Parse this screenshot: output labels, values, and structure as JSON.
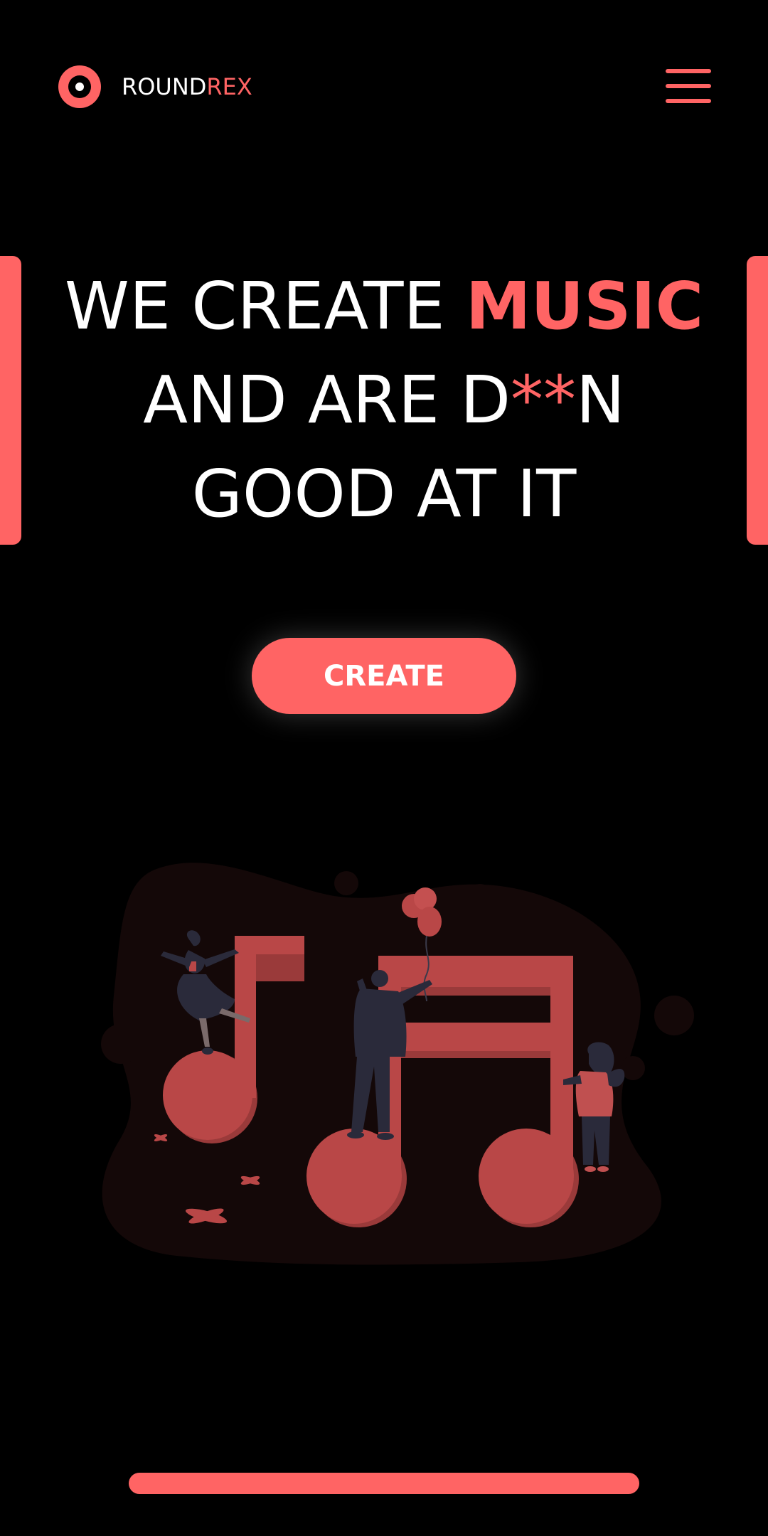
{
  "header": {
    "logo_icon": "record-circle-icon",
    "brand_part1": "ROUND",
    "brand_part2": "REX",
    "menu_icon": "hamburger-menu-icon"
  },
  "hero": {
    "line1_text": "WE CREATE ",
    "line1_accent": "MUSIC",
    "line2_before": "AND ARE D",
    "line2_accent": "**",
    "line2_after": "N",
    "line3": "GOOD AT IT",
    "cta_label": "CREATE"
  },
  "illustration": {
    "name": "music-notes-dancing-people-illustration"
  },
  "colors": {
    "background": "#000000",
    "accent": "#ff6464",
    "text": "#ffffff",
    "note": "#b94747",
    "blob": "#140808"
  }
}
